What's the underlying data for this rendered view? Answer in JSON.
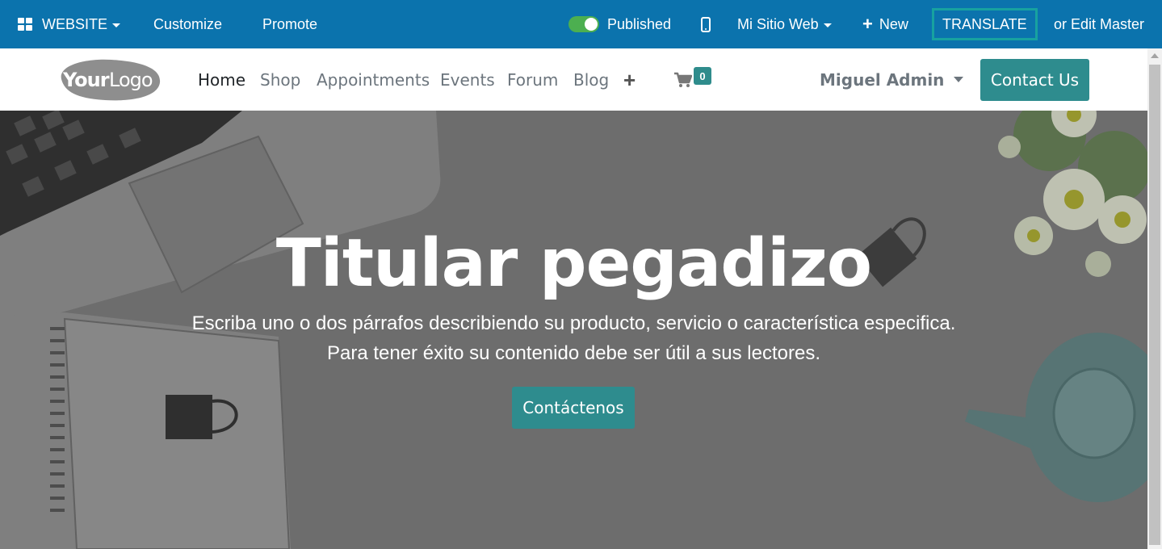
{
  "admin_bar": {
    "website_menu": "WEBSITE",
    "customize": "Customize",
    "promote": "Promote",
    "published": "Published",
    "site_selector": "Mi Sitio Web",
    "new": "New",
    "translate": "TRANSLATE",
    "edit_master": "or Edit Master"
  },
  "nav": {
    "logo_text": "YourLogo",
    "links": [
      "Home",
      "Shop",
      "Appointments",
      "Events",
      "Forum",
      "Blog"
    ],
    "active_link": "Home",
    "cart_count": "0",
    "user": "Miguel Admin",
    "contact_button": "Contact Us"
  },
  "hero": {
    "title": "Titular pegadizo",
    "paragraph_line1": "Escriba uno o dos párrafos describiendo su producto, servicio o característica especifica.",
    "paragraph_line2": "Para tener éxito su contenido debe ser útil a sus lectores.",
    "button": "Contáctenos"
  },
  "colors": {
    "admin_bar": "#0B73AD",
    "accent": "#2E8C8E",
    "translate_border": "#17A2A0",
    "toggle_on": "#4caf50"
  }
}
